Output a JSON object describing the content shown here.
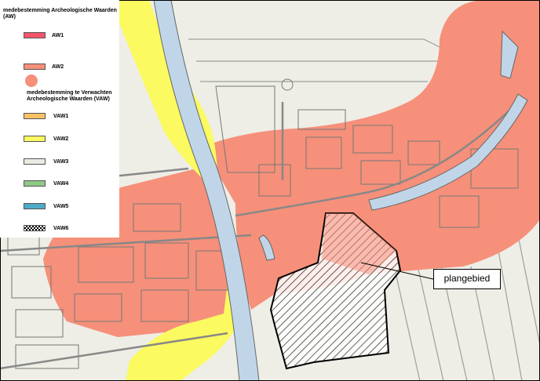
{
  "legend": {
    "aw_title": "medebestemming Archeologische Waarden (AW)",
    "aw1_label": "AW1",
    "aw2_label": "AW2",
    "vaw_title": "medebestemming te Verwachten Archeologische Waarden (VAW)",
    "vaw1_label": "VAW1",
    "vaw2_label": "VAW2",
    "vaw3_label": "VAW3",
    "vaw4_label": "VAW4",
    "vaw5_label": "VAW5",
    "vaw6_label": "VAW6"
  },
  "callout": {
    "label": "plangebied"
  },
  "colors": {
    "aw1": "#f7546c",
    "aw2": "#f6907a",
    "vaw1": "#f9c263",
    "vaw2": "#fbfa60",
    "vaw3": "#ecebe3",
    "vaw4": "#8ec985",
    "vaw5": "#4faac6",
    "background": "#eeeee6",
    "canal": "#c0d6e8"
  }
}
